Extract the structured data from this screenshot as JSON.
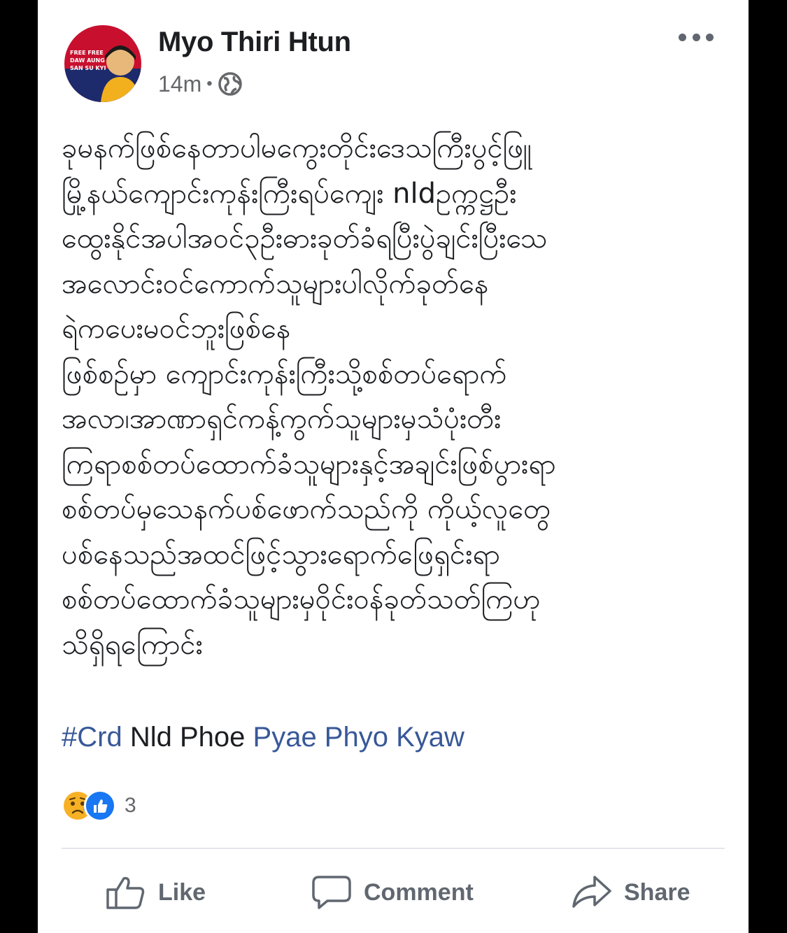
{
  "post": {
    "author": "Myo Thiri Htun",
    "time": "14m",
    "separator": "•",
    "privacy_icon": "globe-icon",
    "more_icon": "more-horizontal-icon",
    "avatar_text": [
      "FREE FREE",
      "DAW AUNG",
      "SAN SU KYI"
    ],
    "body_lines": [
      "ခုမနက်ဖြစ်နေတာပါမကွေးတိုင်းဒေသကြီးပွင့်ဖြူ",
      "မြို့နယ်ကျောင်းကုန်းကြီးရပ်ကျေး nldဥက္ကဋ္ဌဦး",
      "ထွေးနိုင်အပါအဝင်၃ဦးဓားခုတ်ခံရပြီးပွဲချင်းပြီးသေ",
      "အလောင်းဝင်ကောက်သူများပါလိုက်ခုတ်နေ",
      "ရဲကပေးမဝင်ဘူးဖြစ်နေ",
      "ဖြစ်စဉ်မှာ ကျောင်းကုန်းကြီးသို့စစ်တပ်ရောက်",
      "အလာ၊အာဏာရှင်ကန့်ကွက်သူများမှသံပုံးတီး",
      "ကြရာစစ်တပ်ထောက်ခံသူများနှင့်အချင်းဖြစ်ပွားရာ",
      "စစ်တပ်မှသေနက်ပစ်ဖောက်သည်ကို ကိုယ့်လူတွေ",
      "ပစ်နေသည်အထင်ဖြင့်သွားရောက်ဖြေရှင်းရာ",
      "စစ်တပ်ထောက်ခံသူများမှဝိုင်းဝန်ခုတ်သတ်ကြဟု",
      "သိရှိရကြောင်း"
    ],
    "hashtag": "#Crd",
    "tag_plain": "Nld Phoe",
    "tag_person": "Pyae Phyo Kyaw"
  },
  "reactions": {
    "icons": [
      "sad-reaction-icon",
      "like-reaction-icon"
    ],
    "count": "3"
  },
  "actions": {
    "like_label": "Like",
    "comment_label": "Comment",
    "share_label": "Share"
  },
  "colors": {
    "link": "#385898",
    "text": "#1c1e21",
    "secondary": "#65676b",
    "like_blue": "#1877f2",
    "sad_yellow": "#f7b125"
  }
}
